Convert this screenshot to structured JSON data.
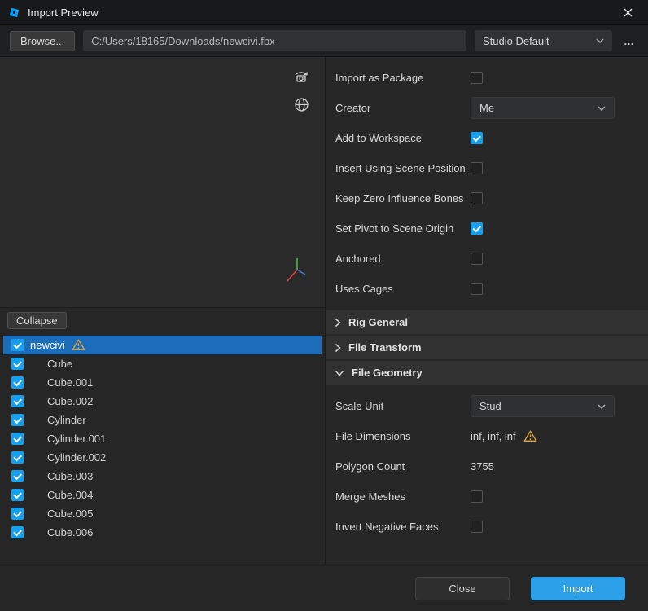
{
  "window": {
    "title": "Import Preview"
  },
  "toolbar": {
    "browse_label": "Browse...",
    "file_path": "C:/Users/18165/Downloads/newcivi.fbx",
    "preset_value": "Studio Default"
  },
  "preview": {
    "collapse_label": "Collapse"
  },
  "tree": {
    "items": [
      {
        "label": "newcivi",
        "checked": true,
        "selected": true,
        "warning": true
      },
      {
        "label": "Cube",
        "checked": true
      },
      {
        "label": "Cube.001",
        "checked": true
      },
      {
        "label": "Cube.002",
        "checked": true
      },
      {
        "label": "Cylinder",
        "checked": true
      },
      {
        "label": "Cylinder.001",
        "checked": true
      },
      {
        "label": "Cylinder.002",
        "checked": true
      },
      {
        "label": "Cube.003",
        "checked": true
      },
      {
        "label": "Cube.004",
        "checked": true
      },
      {
        "label": "Cube.005",
        "checked": true
      },
      {
        "label": "Cube.006",
        "checked": true
      }
    ]
  },
  "settings": {
    "import_as_package": {
      "label": "Import as Package",
      "checked": false
    },
    "creator": {
      "label": "Creator",
      "value": "Me"
    },
    "add_to_workspace": {
      "label": "Add to Workspace",
      "checked": true
    },
    "insert_using_scene_position": {
      "label": "Insert Using Scene Position",
      "checked": false
    },
    "keep_zero_influence_bones": {
      "label": "Keep Zero Influence Bones",
      "checked": false
    },
    "set_pivot_to_scene_origin": {
      "label": "Set Pivot to Scene Origin",
      "checked": true
    },
    "anchored": {
      "label": "Anchored",
      "checked": false
    },
    "uses_cages": {
      "label": "Uses Cages",
      "checked": false
    },
    "sections": {
      "rig_general": {
        "label": "Rig General",
        "expanded": false
      },
      "file_transform": {
        "label": "File Transform",
        "expanded": false
      },
      "file_geometry": {
        "label": "File Geometry",
        "expanded": true
      }
    },
    "scale_unit": {
      "label": "Scale Unit",
      "value": "Stud"
    },
    "file_dimensions": {
      "label": "File Dimensions",
      "value": "inf, inf, inf",
      "warning": true
    },
    "polygon_count": {
      "label": "Polygon Count",
      "value": "3755"
    },
    "merge_meshes": {
      "label": "Merge Meshes",
      "checked": false
    },
    "invert_negative_faces": {
      "label": "Invert Negative Faces",
      "checked": false
    }
  },
  "footer": {
    "close_label": "Close",
    "import_label": "Import"
  },
  "icons": {
    "more": "…"
  },
  "colors": {
    "accent_blue": "#14a0ef",
    "selection_blue": "#1c6db9",
    "import_button_blue": "#2b9fe8",
    "warning_yellow": "#dfa33e"
  }
}
